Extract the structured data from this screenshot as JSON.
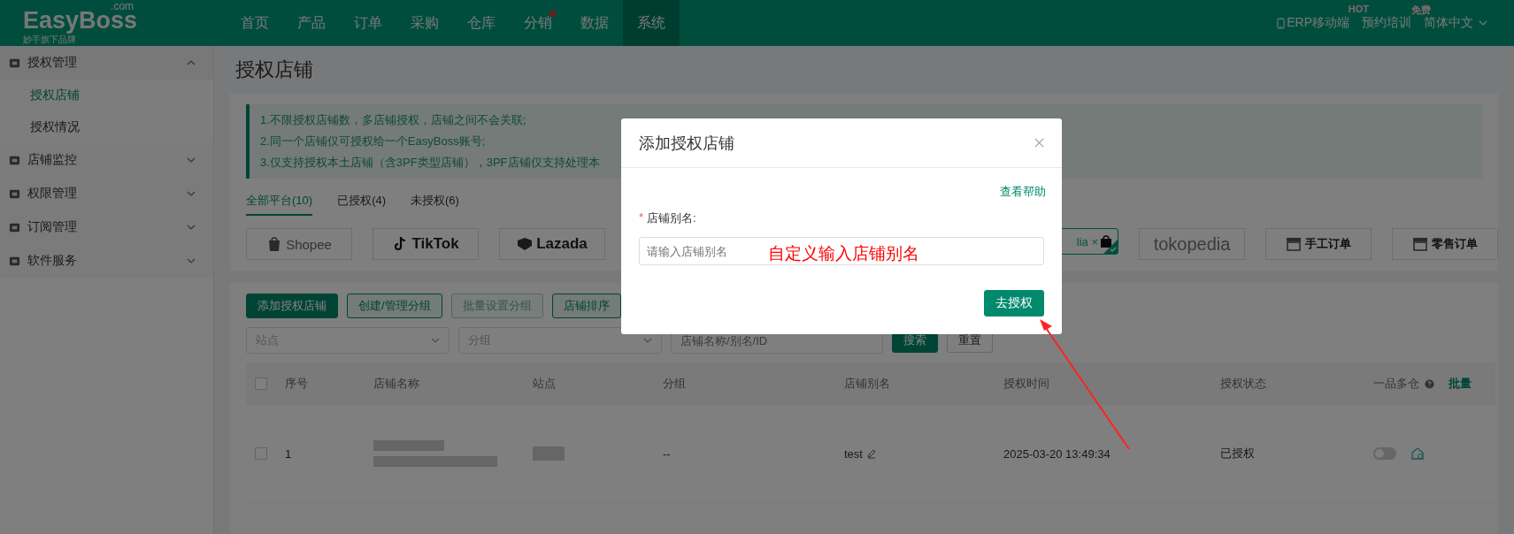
{
  "brand": {
    "logo": "EasyBoss",
    "suffix": ".com",
    "tagline": "妙手旗下品牌"
  },
  "nav": [
    {
      "label": "首页",
      "selected": false,
      "dot": false
    },
    {
      "label": "产品",
      "selected": false,
      "dot": false
    },
    {
      "label": "订单",
      "selected": false,
      "dot": false
    },
    {
      "label": "采购",
      "selected": false,
      "dot": false
    },
    {
      "label": "仓库",
      "selected": false,
      "dot": false
    },
    {
      "label": "分销",
      "selected": false,
      "dot": true
    },
    {
      "label": "数据",
      "selected": false,
      "dot": false
    },
    {
      "label": "系统",
      "selected": true,
      "dot": false
    }
  ],
  "top_right": [
    {
      "kind": "phone",
      "label": "ERP移动端",
      "badge": "HOT"
    },
    {
      "kind": "plain",
      "label": "预约培训",
      "badge": "免费"
    },
    {
      "kind": "dropdown",
      "label": "简体中文"
    }
  ],
  "sidebar": [
    {
      "label": "授权管理",
      "expanded": true,
      "children": [
        {
          "label": "授权店铺",
          "selected": true
        },
        {
          "label": "授权情况",
          "selected": false
        }
      ]
    },
    {
      "label": "店铺监控",
      "expanded": false
    },
    {
      "label": "权限管理",
      "expanded": false
    },
    {
      "label": "订阅管理",
      "expanded": false
    },
    {
      "label": "软件服务",
      "expanded": false
    }
  ],
  "page_title": "授权店铺",
  "notices": [
    "1.不限授权店铺数，多店铺授权，店铺之间不会关联;",
    "2.同一个店铺仅可授权给一个EasyBoss账号;",
    "3.仅支持授权本土店铺（含3PF类型店铺），3PF店铺仅支持处理本"
  ],
  "filter_tabs": [
    {
      "label": "全部平台(10)",
      "selected": true
    },
    {
      "label": "已授权(4)",
      "selected": false
    },
    {
      "label": "未授权(6)",
      "selected": false
    }
  ],
  "platforms": [
    {
      "kind": "shopee",
      "label": "Shopee",
      "selected": false
    },
    {
      "kind": "tiktok",
      "label": "TikTok",
      "selected": false
    },
    {
      "kind": "lazada",
      "label": "Lazada",
      "selected": false
    },
    {
      "kind": "hidden"
    },
    {
      "kind": "partial",
      "label": "lia ×",
      "selected": true
    },
    {
      "kind": "text",
      "label": "tokopedia",
      "selected": false
    },
    {
      "kind": "store",
      "label": "手工订单",
      "selected": false
    },
    {
      "kind": "store",
      "label": "零售订单",
      "selected": false
    }
  ],
  "toolbar": [
    {
      "kind": "primary",
      "label": "添加授权店铺"
    },
    {
      "kind": "default",
      "label": "创建/管理分组"
    },
    {
      "kind": "disabled",
      "label": "批量设置分组"
    },
    {
      "kind": "default",
      "label": "店铺排序"
    }
  ],
  "filters": {
    "site": {
      "placeholder": "站点"
    },
    "group": {
      "placeholder": "分组"
    },
    "search": {
      "placeholder": "店铺名称/别名/ID"
    },
    "search_button": "搜索",
    "reset_button": "重置"
  },
  "table": {
    "columns": [
      "序号",
      "店铺名称",
      "站点",
      "分组",
      "店铺别名",
      "授权时间",
      "授权状态",
      "一品多仓",
      "批量"
    ],
    "select_all": false,
    "rows": [
      {
        "checked": false,
        "index": "1",
        "group": "--",
        "alias": "test",
        "time": "2025-03-20 13:49:34",
        "status": "已授权",
        "multi_warehouse": false
      }
    ]
  },
  "modal": {
    "title": "添加授权店铺",
    "help_link": "查看帮助",
    "field_label": "店铺别名:",
    "required": true,
    "required_mark": "*",
    "placeholder": "请输入店铺别名",
    "submit": "去授权"
  },
  "annotation": {
    "text": "自定义输入店铺别名"
  }
}
